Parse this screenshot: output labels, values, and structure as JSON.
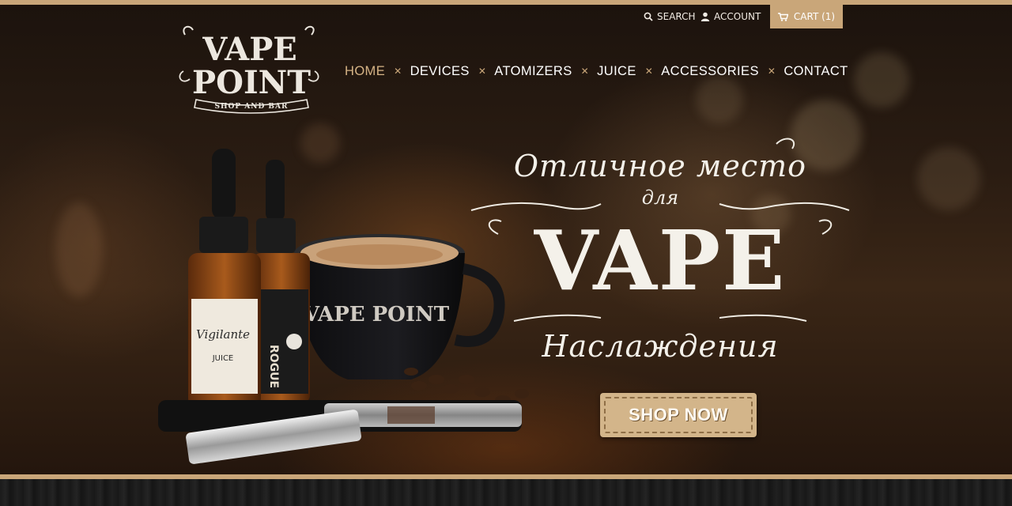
{
  "header": {
    "search_label": "SEARCH",
    "account_label": "ACCOUNT",
    "cart_label": "CART (1)"
  },
  "logo": {
    "text_line1": "VAPE",
    "text_line2": "POINT",
    "tagline": "SHOP AND BAR"
  },
  "nav": {
    "items": [
      {
        "label": "HOME",
        "active": true
      },
      {
        "label": "DEVICES",
        "active": false
      },
      {
        "label": "ATOMIZERS",
        "active": false
      },
      {
        "label": "JUICE",
        "active": false
      },
      {
        "label": "ACCESSORIES",
        "active": false
      },
      {
        "label": "CONTACT",
        "active": false
      }
    ]
  },
  "hero": {
    "headline_line1": "Отличное место",
    "headline_line2": "для",
    "headline_big": "VAPE",
    "headline_line3": "Наслаждения",
    "cta_label": "SHOP NOW",
    "products": {
      "bottle1_label": "Vigilante",
      "bottle1_sub": "JUICE",
      "bottle2_label": "ROGUE",
      "cup_logo": "VAPE POINT"
    }
  },
  "colors": {
    "accent_gold": "#c9a679",
    "button_bg": "#d3b58a",
    "text_light": "#f4f1ea"
  },
  "icons": {
    "search": "search-icon",
    "account": "user-icon",
    "cart": "cart-icon",
    "nav_separator": "cross-separator-icon"
  }
}
